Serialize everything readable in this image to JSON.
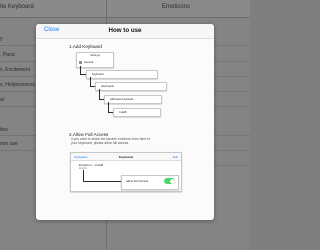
{
  "background": {
    "left_header": "ite Keyboard",
    "right_header": "Emoticons",
    "rows": [
      "y",
      ", Panic",
      "s, Excitement",
      "s, Helplessness",
      "al",
      "ites",
      "non use"
    ]
  },
  "modal": {
    "close_label": "Close",
    "title": "How to use",
    "section1_title": "1.Add Keyboard",
    "steps": {
      "settings": "Settings",
      "general": "General",
      "keyboard": "Keyboard",
      "keyboards": "Keyboards",
      "add_new": "Add New Keyboard...",
      "cute": "CuteB"
    },
    "section2_title": "2.Allow Full Access",
    "description_line1": "If you want to share the favorite emoticon from here to",
    "description_line2": "your keyboard, please allow full access.",
    "ipad": {
      "back": "Keyboards",
      "title": "Keyboards",
      "edit": "Edit",
      "keyboard_name": "Emoticon – CuteB",
      "keyboard_sub": "English",
      "allow_label": "Allow Full Access"
    }
  },
  "colors": {
    "accent": "#1a7cf5",
    "toggle_on": "#4cd964"
  }
}
